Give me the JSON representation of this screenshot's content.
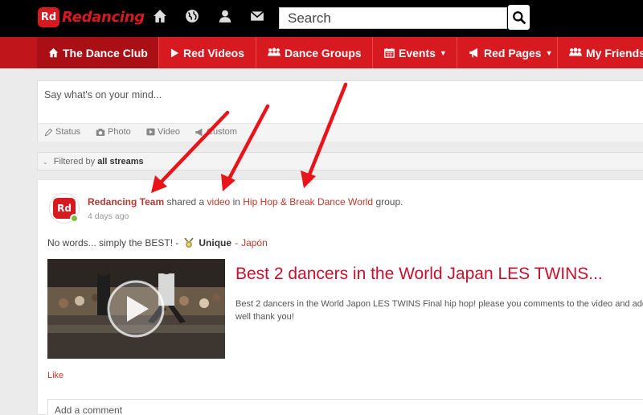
{
  "brand": {
    "logo_badge": "Rd",
    "name": "Redancing",
    "color": "#d71920"
  },
  "topbar": {
    "icons": [
      "home-icon",
      "globe-icon",
      "user-icon",
      "envelope-icon"
    ],
    "search_placeholder": "Search"
  },
  "nav": {
    "items": [
      {
        "label": "The Dance Club",
        "icon": "home-icon"
      },
      {
        "label": "Red Videos",
        "icon": "play-icon"
      },
      {
        "label": "Dance Groups",
        "icon": "group-icon"
      },
      {
        "label": "Events",
        "icon": "calendar-icon"
      },
      {
        "label": "Red Pages",
        "icon": "bullhorn-icon"
      },
      {
        "label": "My Friends",
        "icon": "group-icon"
      }
    ]
  },
  "composer": {
    "placeholder": "Say what's on your mind...",
    "tabs": [
      "Status",
      "Photo",
      "Video",
      "Custom"
    ]
  },
  "filter": {
    "prefix": "Filtered by",
    "value": "all streams"
  },
  "feed": {
    "actor": "Redancing Team",
    "verb_shared": "shared a",
    "object": "video",
    "in_word": "in",
    "group_name": "Hip Hop & Break Dance World",
    "group_word": "group.",
    "time": "4 days ago",
    "post_text": "No words... simply the BEST! -",
    "mood": "Unique",
    "location_sep": "-",
    "location": "Japón",
    "video_title": "Best 2 dancers in the World Japan LES TWINS...",
    "video_desc": "Best 2 dancers in the World Japon LES TWINS Final hip hop! please you comments to the video and add well thank you!",
    "like_label": "Like",
    "comment_placeholder": "Add a comment"
  }
}
